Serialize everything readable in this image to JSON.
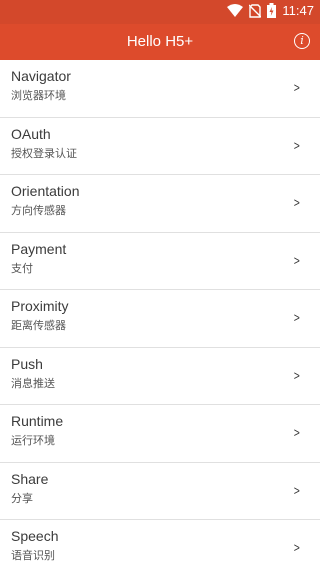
{
  "status": {
    "time": "11:47"
  },
  "header": {
    "title": "Hello H5+"
  },
  "list": [
    {
      "title": "Navigator",
      "subtitle": "浏览器环境"
    },
    {
      "title": "OAuth",
      "subtitle": "授权登录认证"
    },
    {
      "title": "Orientation",
      "subtitle": "方向传感器"
    },
    {
      "title": "Payment",
      "subtitle": "支付"
    },
    {
      "title": "Proximity",
      "subtitle": "距离传感器"
    },
    {
      "title": "Push",
      "subtitle": "消息推送"
    },
    {
      "title": "Runtime",
      "subtitle": "运行环境"
    },
    {
      "title": "Share",
      "subtitle": "分享"
    },
    {
      "title": "Speech",
      "subtitle": "语音识别"
    }
  ],
  "colors": {
    "statusbar": "#d3482b",
    "appbar": "#dd4b2c"
  }
}
